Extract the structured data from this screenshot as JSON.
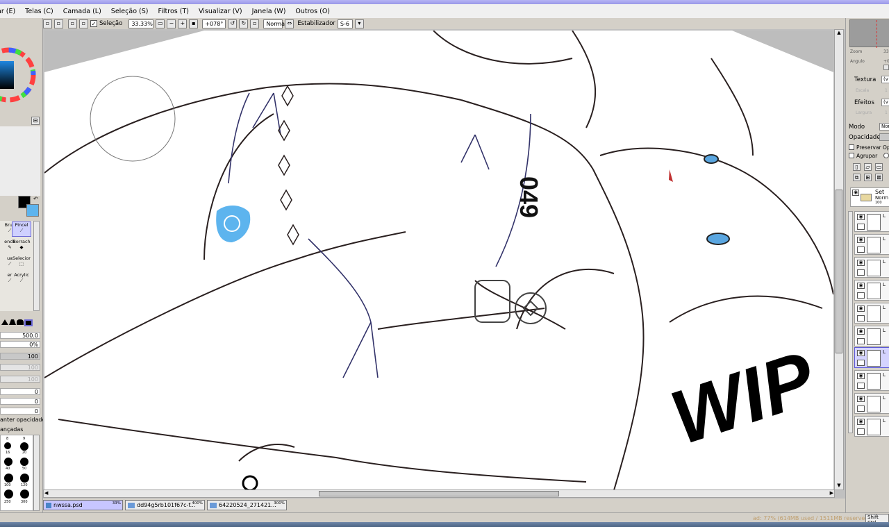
{
  "menu": [
    "ar (E)",
    "Telas (C)",
    "Camada (L)",
    "Seleção (S)",
    "Filtros (T)",
    "Visualizar (V)",
    "Janela (W)",
    "Outros (O)"
  ],
  "toolbar": {
    "selection_label": "Seleção",
    "selection_checked": true,
    "zoom": "33.33%",
    "rotation": "+078°",
    "blend_mode": "Normal",
    "stabilizer_label": "Estabilizador",
    "stabilizer_value": "S-6"
  },
  "left_panel": {
    "tools": [
      "Brus",
      "Pincel",
      "ench",
      "Borrach",
      "ua",
      "Selecior",
      "er",
      "Acrylic"
    ],
    "selected_tool": "Pincel",
    "size_value": "500.0",
    "min_size": "0%",
    "density": "100",
    "values_disabled": [
      "100",
      "100"
    ],
    "zeros": [
      "0",
      "0",
      "0"
    ],
    "keep_opacity_label": "anter opacidade",
    "advanced_label": "ançadas",
    "brush_sizes": [
      "8",
      "9",
      "16",
      "20",
      "40",
      "50",
      "100",
      "120",
      "250",
      "300"
    ]
  },
  "canvas": {
    "watermark": "WIP",
    "jersey_number": "049"
  },
  "tabs": [
    {
      "name": "nwssa.psd",
      "zoom": "33%",
      "active": true
    },
    {
      "name": "dd94g5rb101f67c-f...",
      "zoom": "400%",
      "active": false
    },
    {
      "name": "64220524_271421...",
      "zoom": "300%",
      "active": false
    }
  ],
  "status": {
    "text": "ad: 77% (614MB used / 1511MB reserved)",
    "keys": "Shift Ctrl"
  },
  "right_panel": {
    "zoom_label": "Zoom",
    "zoom_value": "33",
    "angle_label": "Angulo",
    "angle_value": "+0",
    "texture_label": "Textura",
    "texture_value": "(v",
    "scale_label": "Escala",
    "scale_value": "1",
    "effects_label": "Efeitos",
    "effects_value": "(v",
    "width_label": "Largura",
    "width_value": "1",
    "mode_label": "Modo",
    "mode_value": "Nor",
    "opacity_label": "Opacidade",
    "preserve_label": "Preservar Opa",
    "group_label": "Agrupar",
    "folder_name": "Set",
    "folder_mode": "Norm",
    "folder_opacity": "100",
    "layer_initial": "L"
  },
  "colors": {
    "foreground": "#000000",
    "background": "#5db4ee",
    "accent": "#6b68d6"
  }
}
